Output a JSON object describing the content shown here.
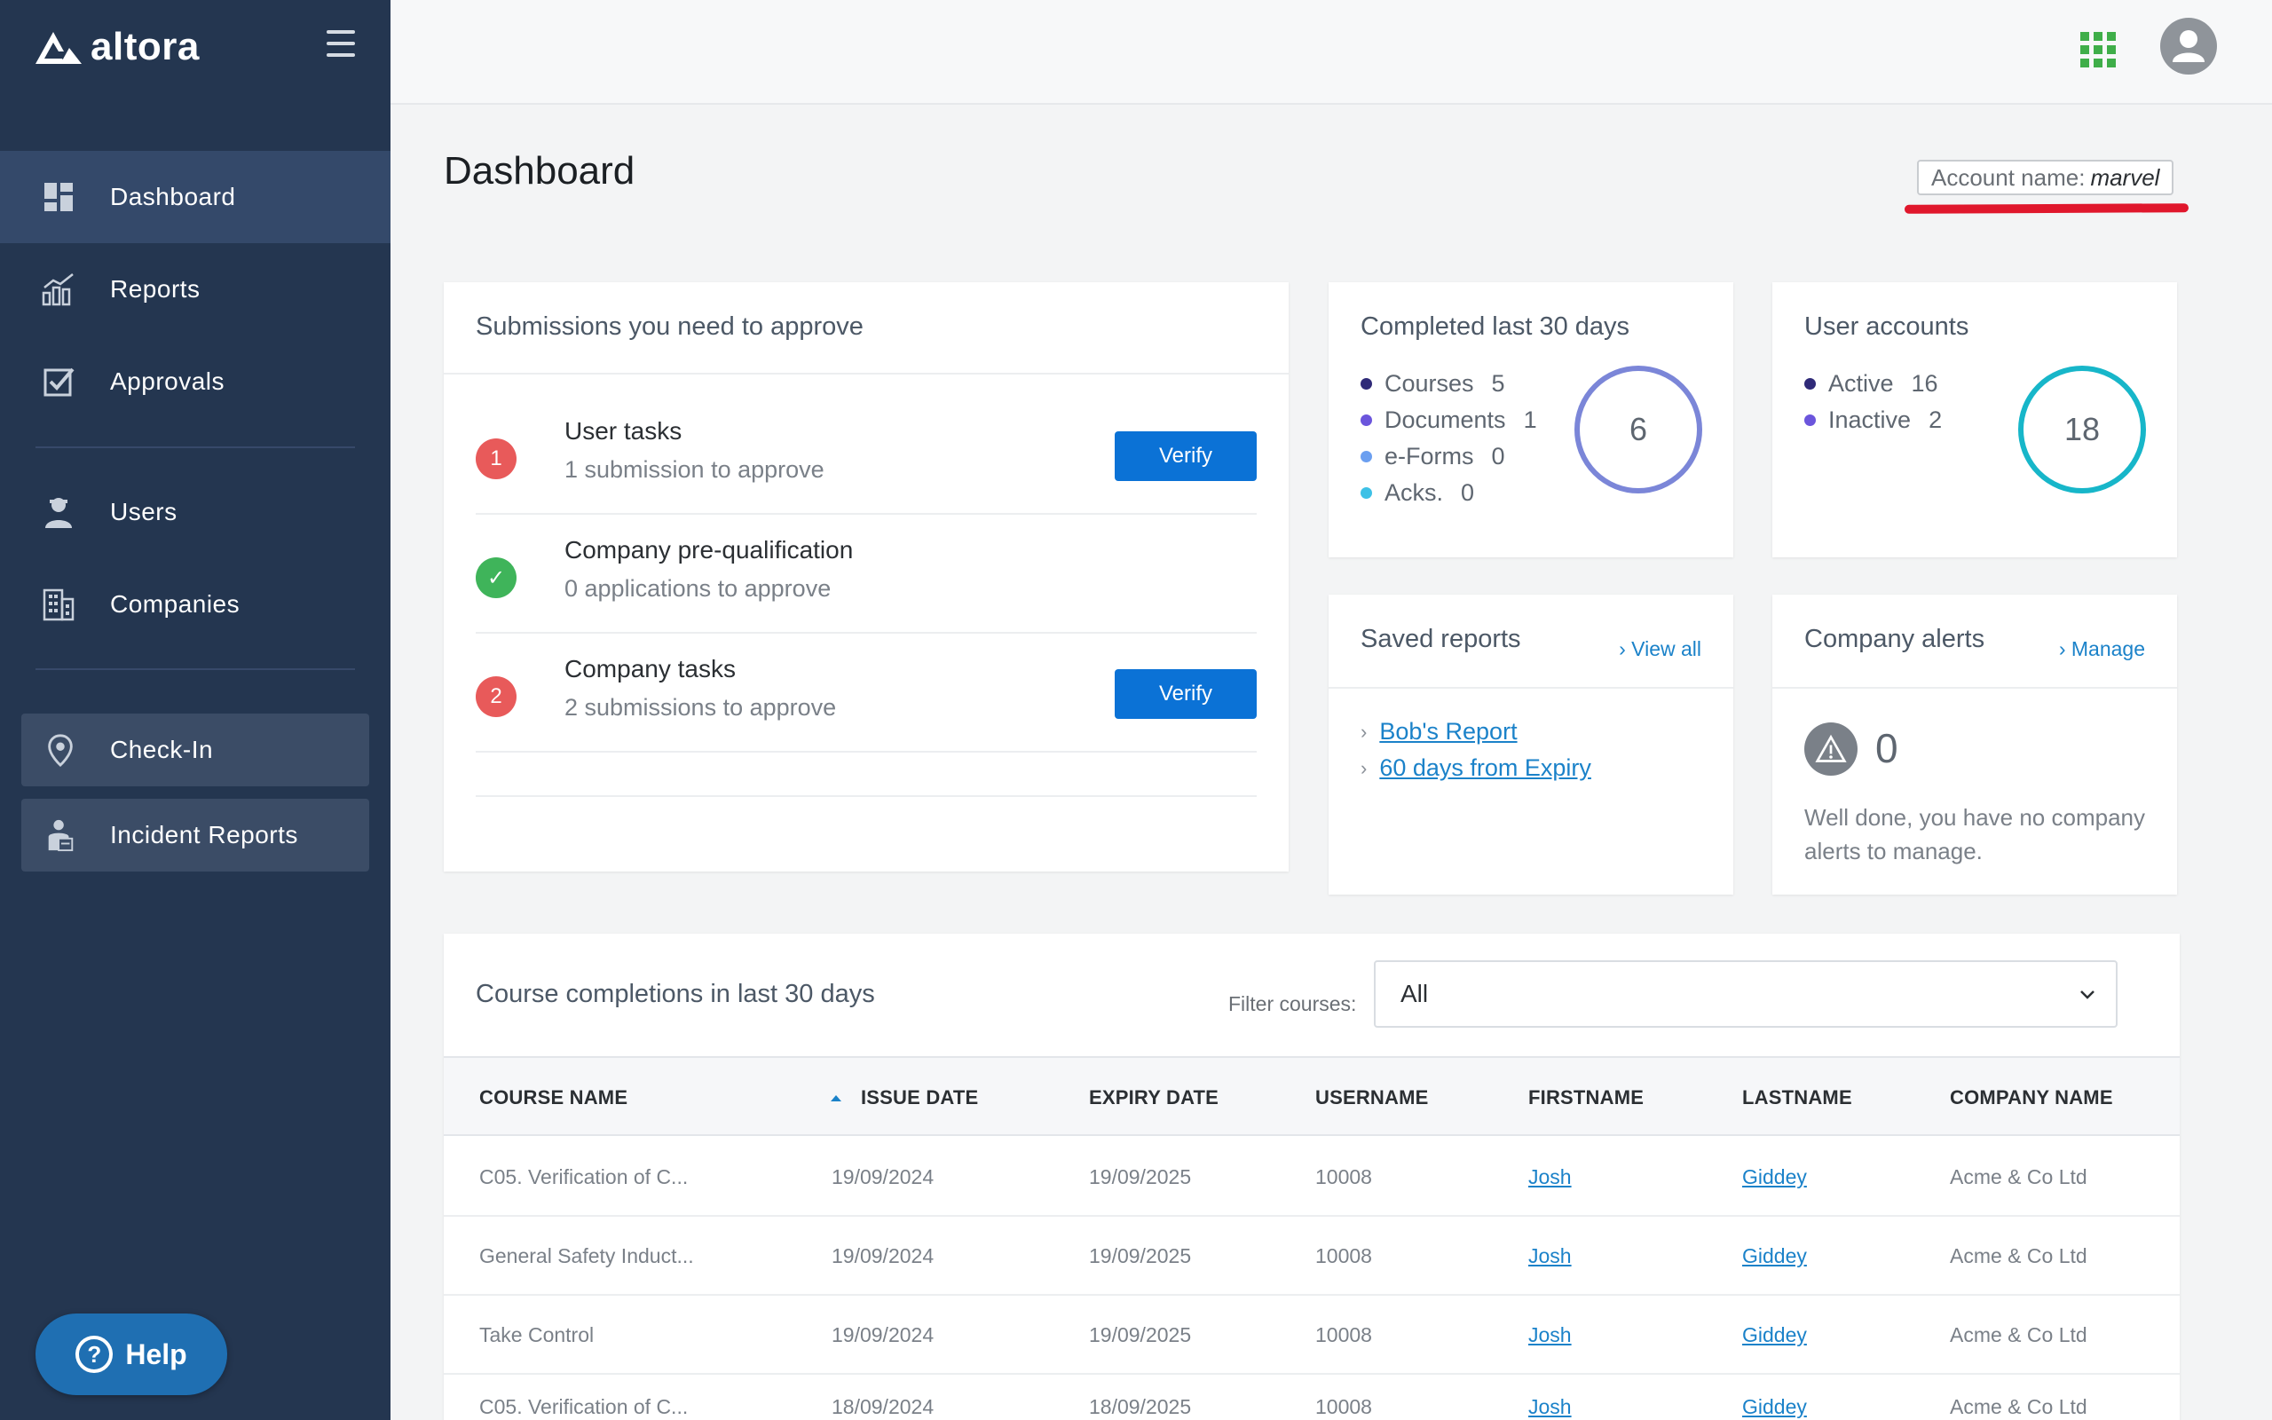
{
  "brand": {
    "name": "altora"
  },
  "nav": {
    "items": [
      {
        "label": "Dashboard",
        "icon": "dashboard-icon"
      },
      {
        "label": "Reports",
        "icon": "chart-icon"
      },
      {
        "label": "Approvals",
        "icon": "checkbox-icon"
      },
      {
        "label": "Users",
        "icon": "user-icon"
      },
      {
        "label": "Companies",
        "icon": "building-icon"
      }
    ],
    "buttons": [
      {
        "label": "Check-In",
        "icon": "location-pin-icon"
      },
      {
        "label": "Incident Reports",
        "icon": "incident-icon"
      }
    ],
    "help_label": "Help"
  },
  "header": {
    "title": "Dashboard",
    "account_label": "Account name:",
    "account_name": "marvel"
  },
  "approvals": {
    "title": "Submissions you need to approve",
    "items": [
      {
        "badge": "1",
        "title": "User tasks",
        "subtitle": "1 submission to approve",
        "button": "Verify"
      },
      {
        "badge": "✓",
        "title": "Company pre-qualification",
        "subtitle": "0 applications to approve"
      },
      {
        "badge": "2",
        "title": "Company tasks",
        "subtitle": "2 submissions to approve",
        "button": "Verify"
      }
    ]
  },
  "completed": {
    "title": "Completed last 30 days",
    "total": "6",
    "items": [
      {
        "label": "Courses",
        "value": "5",
        "color": "#2f2a78"
      },
      {
        "label": "Documents",
        "value": "1",
        "color": "#6b55dc"
      },
      {
        "label": "e-Forms",
        "value": "0",
        "color": "#6b9ff0"
      },
      {
        "label": "Acks.",
        "value": "0",
        "color": "#3dc1e6"
      }
    ],
    "ring_color": "#7b86d8"
  },
  "user_accounts": {
    "title": "User accounts",
    "total": "18",
    "items": [
      {
        "label": "Active",
        "value": "16",
        "color": "#2f2a78"
      },
      {
        "label": "Inactive",
        "value": "2",
        "color": "#6b55dc"
      }
    ],
    "ring_color": "#17b6c9"
  },
  "saved_reports": {
    "title": "Saved reports",
    "view_all": "View all",
    "items": [
      "Bob's Report",
      "60 days from Expiry"
    ]
  },
  "company_alerts": {
    "title": "Company alerts",
    "manage": "Manage",
    "count": "0",
    "message": "Well done, you have no company alerts to manage."
  },
  "courses": {
    "title": "Course completions in last 30 days",
    "filter_label": "Filter courses:",
    "filter_value": "All",
    "columns": [
      "COURSE NAME",
      "ISSUE DATE",
      "EXPIRY DATE",
      "USERNAME",
      "FIRSTNAME",
      "LASTNAME",
      "COMPANY NAME"
    ],
    "rows": [
      [
        "C05. Verification of C...",
        "19/09/2024",
        "19/09/2025",
        "10008",
        "Josh",
        "Giddey",
        "Acme & Co Ltd"
      ],
      [
        "General Safety Induct...",
        "19/09/2024",
        "19/09/2025",
        "10008",
        "Josh",
        "Giddey",
        "Acme & Co Ltd"
      ],
      [
        "Take Control",
        "19/09/2024",
        "19/09/2025",
        "10008",
        "Josh",
        "Giddey",
        "Acme & Co Ltd"
      ],
      [
        "C05. Verification of C...",
        "18/09/2024",
        "18/09/2025",
        "10008",
        "Josh",
        "Giddey",
        "Acme & Co Ltd"
      ]
    ]
  }
}
